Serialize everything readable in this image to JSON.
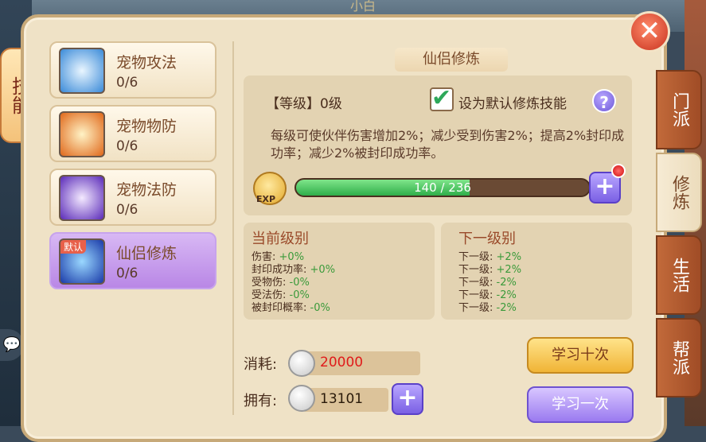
{
  "window": {
    "top_title": "小白"
  },
  "left_tab": {
    "label": "技能"
  },
  "pets": [
    {
      "name": "宠物攻法",
      "count": "0/6",
      "icon": "pet-attack-icon",
      "color": "#5aa8e8"
    },
    {
      "name": "宠物物防",
      "count": "0/6",
      "icon": "pet-defense-icon",
      "color": "#e8762a"
    },
    {
      "name": "宠物法防",
      "count": "0/6",
      "icon": "pet-magic-defense-icon",
      "color": "#7a4ad8"
    },
    {
      "name": "仙侣修炼",
      "count": "0/6",
      "icon": "partner-cultivation-icon",
      "color": "#3a5ad8",
      "tag": "默认",
      "active": true
    }
  ],
  "main": {
    "section_title": "仙侣修炼",
    "level_label": "【等级】0级",
    "default_checkbox": {
      "label": "设为默认修炼技能",
      "checked": true
    },
    "help_label": "?",
    "description": "每级可使伙伴伤害增加2%；减少受到伤害2%；提高2%封印成功率；减少2%被封印成功率。",
    "exp": {
      "text": "EXP",
      "label": "140 / 236",
      "current": 140,
      "max": 236,
      "progress": 0.593
    }
  },
  "current_level": {
    "title": "当前级别",
    "lines": [
      {
        "label": "伤害:",
        "value": "+0%"
      },
      {
        "label": "封印成功率:",
        "value": "+0%"
      },
      {
        "label": "受物伤:",
        "value": "-0%"
      },
      {
        "label": "受法伤:",
        "value": "-0%"
      },
      {
        "label": "被封印概率:",
        "value": "-0%"
      }
    ]
  },
  "next_level": {
    "title": "下一级别",
    "lines": [
      {
        "label": "下一级:",
        "value": "+2%"
      },
      {
        "label": "下一级:",
        "value": "+2%"
      },
      {
        "label": "下一级:",
        "value": "-2%"
      },
      {
        "label": "下一级:",
        "value": "-2%"
      },
      {
        "label": "下一级:",
        "value": "-2%"
      }
    ]
  },
  "cost": {
    "label": "消耗:",
    "value": "20000",
    "value_color": "#e01a1a"
  },
  "own": {
    "label": "拥有:",
    "value": "13101",
    "value_color": "#2a1a0a"
  },
  "buttons": {
    "learn_ten": "学习十次",
    "learn_once": "学习一次",
    "plus": "+",
    "close": "✕"
  },
  "side_tabs": [
    {
      "label": "门派",
      "active": false
    },
    {
      "label": "修炼",
      "active": true
    },
    {
      "label": "生活",
      "active": false
    },
    {
      "label": "帮派",
      "active": false
    }
  ]
}
